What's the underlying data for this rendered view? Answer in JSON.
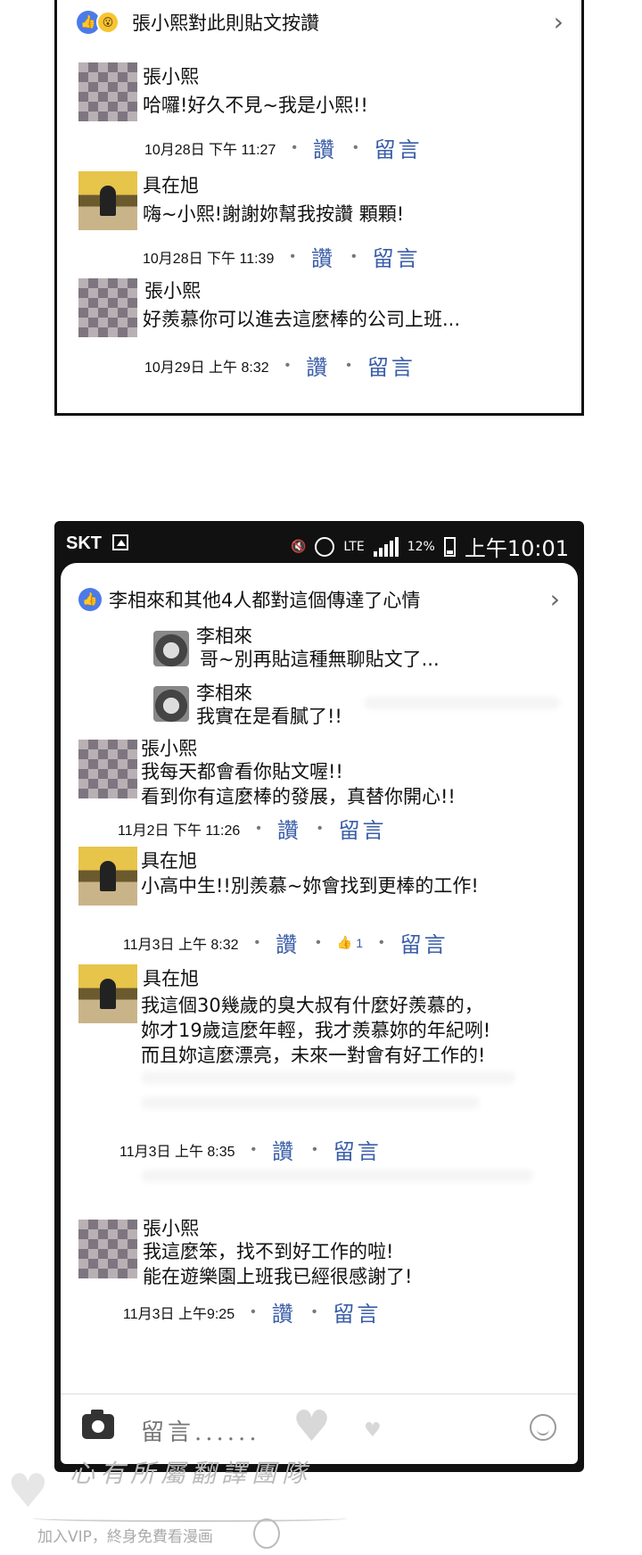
{
  "panel1": {
    "header": "張小熙對此則貼文按讚",
    "comments": [
      {
        "name": "張小熙",
        "text": "哈囉!好久不見~我是小熙!!",
        "time": "10月28日 下午 11:27",
        "like": "讚",
        "reply": "留言"
      },
      {
        "name": "具在旭",
        "text": "嗨~小熙!謝謝妳幫我按讚 顆顆!",
        "time": "10月28日 下午 11:39",
        "like": "讚",
        "reply": "留言"
      },
      {
        "name": "張小熙",
        "text": "好羨慕你可以進去這麼棒的公司上班...",
        "time": "10月29日 上午 8:32",
        "like": "讚",
        "reply": "留言"
      }
    ]
  },
  "status_bar": {
    "carrier": "SKT",
    "lte": "LTE",
    "battery": "12%",
    "time": "上午10:01"
  },
  "panel2": {
    "header": "李相來和其他4人都對這個傳達了心情",
    "replies": [
      {
        "name": "李相來",
        "text": "哥~別再貼這種無聊貼文了..."
      },
      {
        "name": "李相來",
        "text": "我實在是看膩了!!"
      }
    ],
    "comments": [
      {
        "name": "張小熙",
        "text": "我每天都會看你貼文喔!!\n看到你有這麼棒的發展，真替你開心!!",
        "time": "11月2日 下午 11:26",
        "like": "讚",
        "reply": "留言"
      },
      {
        "name": "具在旭",
        "text": "小高中生!!別羨慕~妳會找到更棒的工作!",
        "time": "11月3日 上午 8:32",
        "like": "讚",
        "like_count": "1",
        "reply": "留言"
      },
      {
        "name": "具在旭",
        "text": "我這個30幾歲的臭大叔有什麼好羨慕的，\n妳才19歲這麼年輕，我才羨慕妳的年紀咧!\n而且妳這麼漂亮，未來一對會有好工作的!",
        "time": "11月3日 上午 8:35",
        "like": "讚",
        "reply": "留言"
      },
      {
        "name": "張小熙",
        "text": "我這麼笨，找不到好工作的啦!\n能在遊樂園上班我已經很感謝了!",
        "time": "11月3日 上午9:25",
        "like": "讚",
        "reply": "留言"
      }
    ],
    "input_placeholder": "留言......"
  },
  "watermark": {
    "line1": "心有所屬翻譯團隊",
    "line2": "加入VIP，終身免費看漫画"
  },
  "icons": {
    "like": "like-icon",
    "wow": "wow-icon",
    "chevron": "chevron-right-icon",
    "camera": "camera-icon",
    "emoji": "emoji-icon"
  },
  "colors": {
    "accent": "#4a7be8",
    "action_text": "#3b5ea8"
  }
}
